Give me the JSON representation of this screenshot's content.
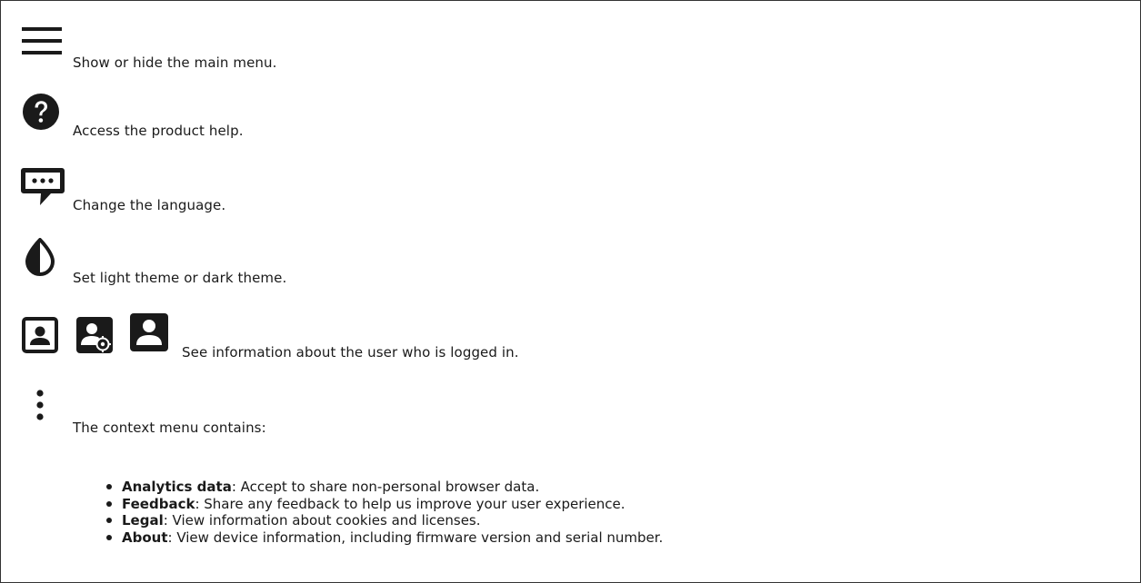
{
  "items": [
    {
      "icon": "hamburger-menu-icon",
      "text": "Show or hide the main menu."
    },
    {
      "icon": "help-circle-icon",
      "text": "Access the product help."
    },
    {
      "icon": "language-chat-icon",
      "text": "Change the language."
    },
    {
      "icon": "theme-contrast-icon",
      "text": "Set light theme or dark theme."
    },
    {
      "icons": [
        "user-outline-icon",
        "user-settings-icon",
        "user-filled-icon"
      ],
      "text": "See information about the user who is logged in."
    },
    {
      "icon": "vertical-dots-icon",
      "text": "The context menu contains:"
    }
  ],
  "context_menu": [
    {
      "term": "Analytics data",
      "desc": ": Accept to share non-personal browser data."
    },
    {
      "term": "Feedback",
      "desc": ": Share any feedback to help us improve your user experience."
    },
    {
      "term": "Legal",
      "desc": ": View information about cookies and licenses."
    },
    {
      "term": "About",
      "desc": ": View device information, including firmware version and serial number."
    }
  ]
}
